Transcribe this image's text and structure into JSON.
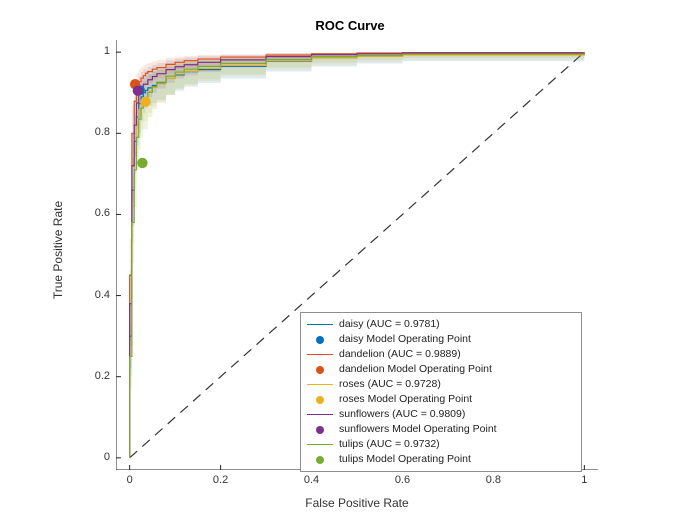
{
  "chart_data": {
    "type": "line",
    "title": "ROC Curve",
    "xlabel": "False Positive Rate",
    "ylabel": "True Positive Rate",
    "xlim": [
      -0.03,
      1.03
    ],
    "ylim": [
      -0.03,
      1.03
    ],
    "xticks": [
      0,
      0.2,
      0.4,
      0.6,
      0.8,
      1
    ],
    "yticks": [
      0,
      0.2,
      0.4,
      0.6,
      0.8,
      1
    ],
    "diagonal": {
      "x": [
        0,
        1
      ],
      "y": [
        0,
        1
      ]
    },
    "series": [
      {
        "name": "daisy",
        "color": "#0072bd",
        "auc": 0.9781,
        "x": [
          0,
          0,
          0.005,
          0.01,
          0.015,
          0.02,
          0.025,
          0.03,
          0.035,
          0.04,
          0.05,
          0.06,
          0.08,
          0.1,
          0.12,
          0.15,
          0.2,
          0.3,
          0.4,
          0.5,
          0.6,
          1
        ],
        "y": [
          0,
          0.3,
          0.66,
          0.78,
          0.84,
          0.873,
          0.89,
          0.9,
          0.906,
          0.912,
          0.918,
          0.924,
          0.936,
          0.944,
          0.952,
          0.957,
          0.965,
          0.978,
          0.986,
          0.99,
          0.994,
          1
        ],
        "y_lo": [
          0,
          0.22,
          0.57,
          0.7,
          0.77,
          0.8,
          0.83,
          0.85,
          0.862,
          0.868,
          0.875,
          0.882,
          0.895,
          0.905,
          0.915,
          0.924,
          0.935,
          0.952,
          0.965,
          0.972,
          0.978,
          1
        ],
        "y_hi": [
          0,
          0.38,
          0.74,
          0.85,
          0.9,
          0.923,
          0.933,
          0.938,
          0.942,
          0.946,
          0.952,
          0.956,
          0.963,
          0.969,
          0.974,
          0.978,
          0.984,
          0.991,
          0.995,
          0.997,
          0.999,
          1
        ],
        "operating_point": {
          "x": 0.022,
          "y": 0.906
        }
      },
      {
        "name": "dandelion",
        "color": "#d95319",
        "auc": 0.9889,
        "x": [
          0,
          0,
          0.005,
          0.01,
          0.015,
          0.02,
          0.025,
          0.03,
          0.035,
          0.04,
          0.05,
          0.06,
          0.08,
          0.1,
          0.12,
          0.15,
          0.2,
          0.3,
          0.4,
          0.5,
          0.6,
          1
        ],
        "y": [
          0,
          0.45,
          0.8,
          0.879,
          0.913,
          0.927,
          0.936,
          0.942,
          0.948,
          0.952,
          0.958,
          0.962,
          0.97,
          0.975,
          0.979,
          0.983,
          0.988,
          0.993,
          0.996,
          0.998,
          0.999,
          1
        ],
        "y_lo": [
          0,
          0.36,
          0.72,
          0.82,
          0.87,
          0.895,
          0.905,
          0.913,
          0.919,
          0.924,
          0.931,
          0.937,
          0.946,
          0.953,
          0.959,
          0.964,
          0.972,
          0.982,
          0.988,
          0.991,
          0.994,
          1
        ],
        "y_hi": [
          0,
          0.54,
          0.87,
          0.926,
          0.948,
          0.957,
          0.963,
          0.968,
          0.971,
          0.974,
          0.978,
          0.981,
          0.986,
          0.989,
          0.991,
          0.993,
          0.995,
          0.998,
          0.999,
          0.999,
          1.0,
          1
        ],
        "operating_point": {
          "x": 0.012,
          "y": 0.921
        }
      },
      {
        "name": "roses",
        "color": "#edb120",
        "auc": 0.9728,
        "x": [
          0,
          0,
          0.005,
          0.01,
          0.015,
          0.02,
          0.025,
          0.03,
          0.04,
          0.05,
          0.06,
          0.08,
          0.1,
          0.12,
          0.15,
          0.2,
          0.3,
          0.4,
          0.5,
          0.6,
          1
        ],
        "y": [
          0,
          0.28,
          0.62,
          0.75,
          0.82,
          0.858,
          0.876,
          0.887,
          0.903,
          0.913,
          0.922,
          0.936,
          0.946,
          0.953,
          0.96,
          0.967,
          0.979,
          0.986,
          0.99,
          0.993,
          1
        ],
        "y_lo": [
          0,
          0.2,
          0.53,
          0.66,
          0.74,
          0.79,
          0.81,
          0.83,
          0.85,
          0.865,
          0.877,
          0.894,
          0.908,
          0.918,
          0.928,
          0.94,
          0.956,
          0.967,
          0.975,
          0.981,
          1
        ],
        "y_hi": [
          0,
          0.36,
          0.7,
          0.82,
          0.88,
          0.91,
          0.922,
          0.93,
          0.943,
          0.951,
          0.958,
          0.967,
          0.973,
          0.978,
          0.983,
          0.988,
          0.993,
          0.996,
          0.998,
          0.999,
          1
        ],
        "operating_point": {
          "x": 0.035,
          "y": 0.878
        }
      },
      {
        "name": "sunflowers",
        "color": "#7e2f8e",
        "auc": 0.9809,
        "x": [
          0,
          0,
          0.005,
          0.01,
          0.015,
          0.02,
          0.025,
          0.03,
          0.04,
          0.05,
          0.06,
          0.08,
          0.1,
          0.12,
          0.15,
          0.2,
          0.3,
          0.4,
          0.5,
          0.6,
          1
        ],
        "y": [
          0,
          0.38,
          0.72,
          0.82,
          0.875,
          0.901,
          0.913,
          0.921,
          0.932,
          0.94,
          0.947,
          0.957,
          0.964,
          0.969,
          0.975,
          0.981,
          0.989,
          0.994,
          0.996,
          0.998,
          1
        ],
        "y_lo": [
          0,
          0.29,
          0.63,
          0.74,
          0.81,
          0.84,
          0.86,
          0.873,
          0.889,
          0.9,
          0.91,
          0.924,
          0.935,
          0.943,
          0.951,
          0.962,
          0.975,
          0.983,
          0.988,
          0.992,
          1
        ],
        "y_hi": [
          0,
          0.46,
          0.8,
          0.89,
          0.925,
          0.942,
          0.951,
          0.957,
          0.964,
          0.969,
          0.973,
          0.98,
          0.984,
          0.987,
          0.99,
          0.993,
          0.997,
          0.998,
          0.999,
          1.0,
          1
        ],
        "operating_point": {
          "x": 0.018,
          "y": 0.905
        }
      },
      {
        "name": "tulips",
        "color": "#77ac30",
        "auc": 0.9732,
        "x": [
          0,
          0,
          0.005,
          0.01,
          0.015,
          0.02,
          0.025,
          0.03,
          0.04,
          0.05,
          0.06,
          0.08,
          0.1,
          0.12,
          0.15,
          0.2,
          0.3,
          0.4,
          0.5,
          0.6,
          1
        ],
        "y": [
          0,
          0.25,
          0.58,
          0.71,
          0.79,
          0.835,
          0.862,
          0.878,
          0.901,
          0.915,
          0.926,
          0.941,
          0.951,
          0.958,
          0.965,
          0.972,
          0.982,
          0.989,
          0.992,
          0.995,
          1
        ],
        "y_lo": [
          0,
          0.17,
          0.48,
          0.62,
          0.71,
          0.76,
          0.79,
          0.81,
          0.84,
          0.86,
          0.875,
          0.895,
          0.91,
          0.921,
          0.933,
          0.945,
          0.962,
          0.974,
          0.981,
          0.986,
          1
        ],
        "y_hi": [
          0,
          0.33,
          0.67,
          0.79,
          0.86,
          0.9,
          0.918,
          0.93,
          0.946,
          0.955,
          0.963,
          0.972,
          0.978,
          0.982,
          0.986,
          0.99,
          0.994,
          0.997,
          0.998,
          0.999,
          1
        ],
        "operating_point": {
          "x": 0.028,
          "y": 0.727
        }
      }
    ]
  },
  "legend": {
    "items": [
      {
        "label": "daisy (AUC = 0.9781)",
        "type": "line",
        "color": "#0072bd"
      },
      {
        "label": "daisy Model Operating Point",
        "type": "dot",
        "color": "#0072bd"
      },
      {
        "label": "dandelion (AUC = 0.9889)",
        "type": "line",
        "color": "#d95319"
      },
      {
        "label": "dandelion Model Operating Point",
        "type": "dot",
        "color": "#d95319"
      },
      {
        "label": "roses (AUC = 0.9728)",
        "type": "line",
        "color": "#edb120"
      },
      {
        "label": "roses Model Operating Point",
        "type": "dot",
        "color": "#edb120"
      },
      {
        "label": "sunflowers (AUC = 0.9809)",
        "type": "line",
        "color": "#7e2f8e"
      },
      {
        "label": "sunflowers Model Operating Point",
        "type": "dot",
        "color": "#7e2f8e"
      },
      {
        "label": "tulips (AUC = 0.9732)",
        "type": "line",
        "color": "#77ac30"
      },
      {
        "label": "tulips Model Operating Point",
        "type": "dot",
        "color": "#77ac30"
      }
    ]
  }
}
